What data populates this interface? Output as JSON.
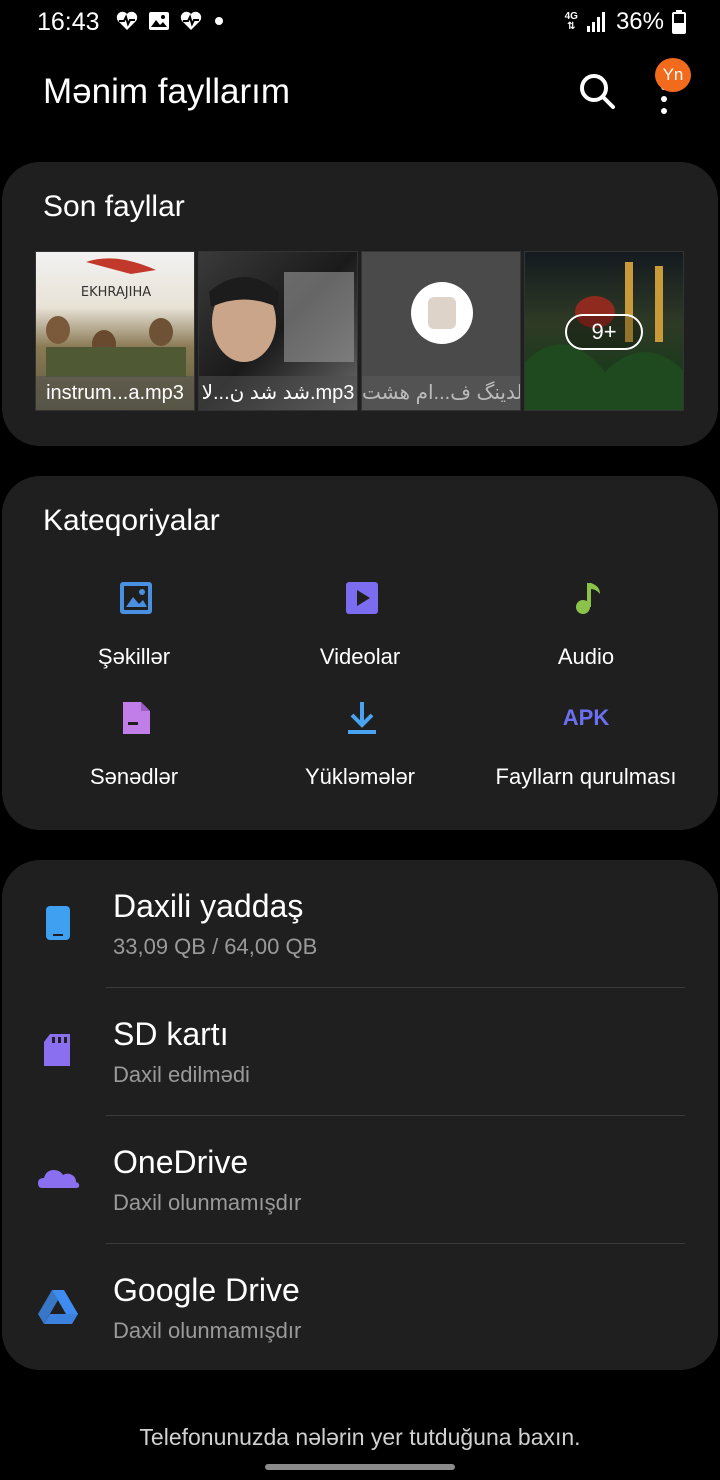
{
  "status_bar": {
    "time": "16:43",
    "network": "4G",
    "battery": "36%"
  },
  "header": {
    "title": "Mənim fayllarım",
    "avatar_initials": "Yn",
    "avatar_color": "#f26a1b"
  },
  "recent": {
    "title": "Son fayllar",
    "items": [
      {
        "label": "instrum...a.mp3"
      },
      {
        "label": "شد شد ن...لا.mp3"
      },
      {
        "label": "علدینگ ف...ام هشت"
      },
      {
        "label": "",
        "more_count": "9+"
      }
    ]
  },
  "categories": {
    "title": "Kateqoriyalar",
    "items": [
      {
        "label": "Şəkillər",
        "icon": "image-icon",
        "color": "#4a90e2"
      },
      {
        "label": "Videolar",
        "icon": "video-icon",
        "color": "#7b6cf0"
      },
      {
        "label": "Audio",
        "icon": "music-note-icon",
        "color": "#8bc34a"
      },
      {
        "label": "Sənədlər",
        "icon": "document-icon",
        "color": "#c27ee8"
      },
      {
        "label": "Yükləmələr",
        "icon": "download-icon",
        "color": "#4aa3f0"
      },
      {
        "label": "Fayllarn qurulması",
        "icon": "apk-icon",
        "icon_text": "APK",
        "color": "#6b6ff0"
      }
    ]
  },
  "storage": {
    "items": [
      {
        "title": "Daxili yaddaş",
        "subtitle": "33,09 QB / 64,00 QB",
        "icon": "phone-storage-icon",
        "color": "#3fa0f2"
      },
      {
        "title": "SD kartı",
        "subtitle": "Daxil edilmədi",
        "icon": "sd-card-icon",
        "color": "#8a6ff0"
      },
      {
        "title": "OneDrive",
        "subtitle": "Daxil olunmamışdır",
        "icon": "onedrive-icon",
        "color": "#8a6ff0"
      },
      {
        "title": "Google Drive",
        "subtitle": "Daxil olunmamışdır",
        "icon": "google-drive-icon",
        "color": "#3f8cf0"
      }
    ]
  },
  "footer": {
    "text": "Telefonunuzda nələrin yer tutduğuna baxın."
  }
}
